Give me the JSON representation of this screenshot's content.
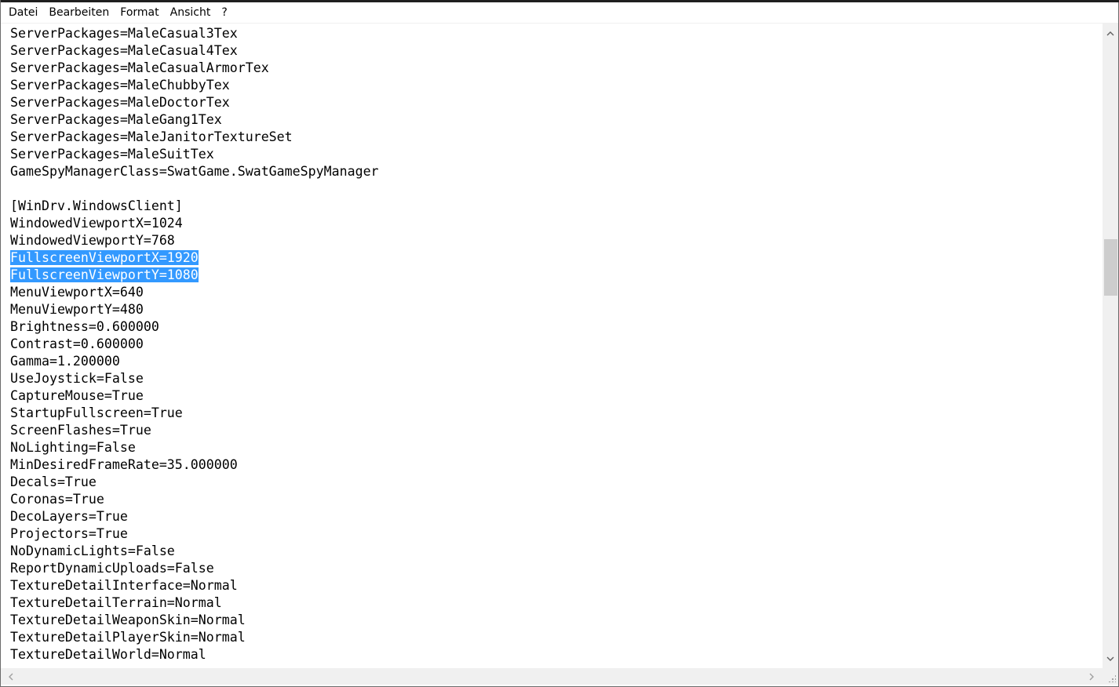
{
  "menu": [
    "Datei",
    "Bearbeiten",
    "Format",
    "Ansicht",
    "?"
  ],
  "editor": {
    "lines": [
      "ServerPackages=MaleCasual3Tex",
      "ServerPackages=MaleCasual4Tex",
      "ServerPackages=MaleCasualArmorTex",
      "ServerPackages=MaleChubbyTex",
      "ServerPackages=MaleDoctorTex",
      "ServerPackages=MaleGang1Tex",
      "ServerPackages=MaleJanitorTextureSet",
      "ServerPackages=MaleSuitTex",
      "GameSpyManagerClass=SwatGame.SwatGameSpyManager",
      "",
      "[WinDrv.WindowsClient]",
      "WindowedViewportX=1024",
      "WindowedViewportY=768",
      "FullscreenViewportX=1920",
      "FullscreenViewportY=1080",
      "MenuViewportX=640",
      "MenuViewportY=480",
      "Brightness=0.600000",
      "Contrast=0.600000",
      "Gamma=1.200000",
      "UseJoystick=False",
      "CaptureMouse=True",
      "StartupFullscreen=True",
      "ScreenFlashes=True",
      "NoLighting=False",
      "MinDesiredFrameRate=35.000000",
      "Decals=True",
      "Coronas=True",
      "DecoLayers=True",
      "Projectors=True",
      "NoDynamicLights=False",
      "ReportDynamicUploads=False",
      "TextureDetailInterface=Normal",
      "TextureDetailTerrain=Normal",
      "TextureDetailWeaponSkin=Normal",
      "TextureDetailPlayerSkin=Normal",
      "TextureDetailWorld=Normal"
    ],
    "selected_lines": [
      13,
      14
    ],
    "selection_color": "#3399ff"
  },
  "icons": {
    "scroll_up": "chevron-up-icon",
    "scroll_down": "chevron-down-icon",
    "scroll_left": "chevron-left-icon",
    "scroll_right": "chevron-right-icon",
    "resize_grip": "resize-grip-icon"
  }
}
